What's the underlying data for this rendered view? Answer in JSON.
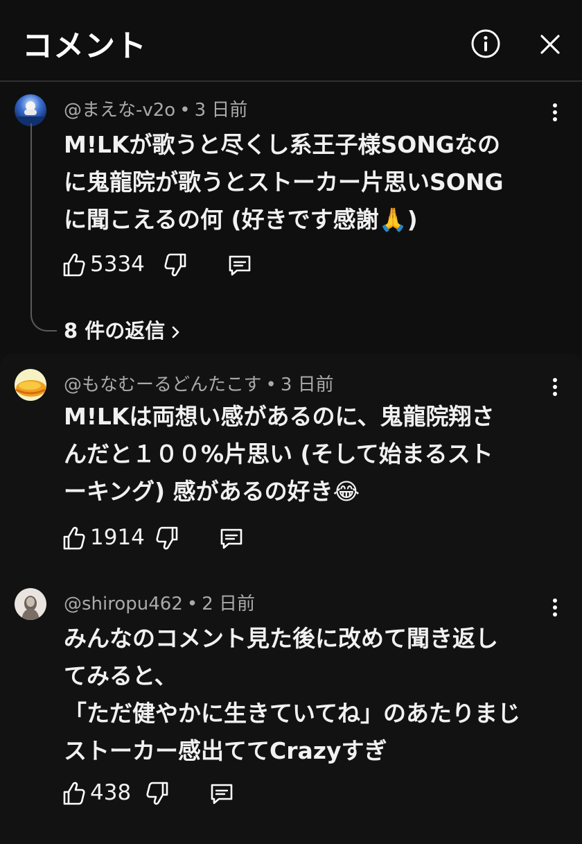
{
  "header": {
    "title": "コメント",
    "info_icon": "info-circle-icon",
    "close_icon": "close-icon"
  },
  "comments": [
    {
      "author": "@まえな-v2o",
      "time": "3 日前",
      "text_lines": [
        "M!LKが歌うと尽くし系王子様SONGなの",
        "に鬼龍院が歌うとストーカー片思いSONG",
        "に聞こえるの何 (好きです感謝🙏)"
      ],
      "likes": "5334",
      "replies": "8 件の返信"
    },
    {
      "author": "@もなむーるどんたこす",
      "time": "3 日前",
      "text_lines": [
        "M!LKは両想い感があるのに、鬼龍院翔さ",
        "んだと１００%片思い (そして始まるスト",
        "ーキング) 感があるの好き😂"
      ],
      "likes": "1914"
    },
    {
      "author": "@shiropu462",
      "time": "2 日前",
      "text_lines": [
        "みんなのコメント見た後に改めて聞き返し",
        "てみると、",
        "「ただ健やかに生きていてね」のあたりまじ",
        "ストーカー感出ててCrazyすぎ"
      ],
      "likes": "438"
    }
  ],
  "colors": {
    "background": "#0f0f0f",
    "text": "#f1f1f1",
    "meta": "#aaaaaa"
  }
}
